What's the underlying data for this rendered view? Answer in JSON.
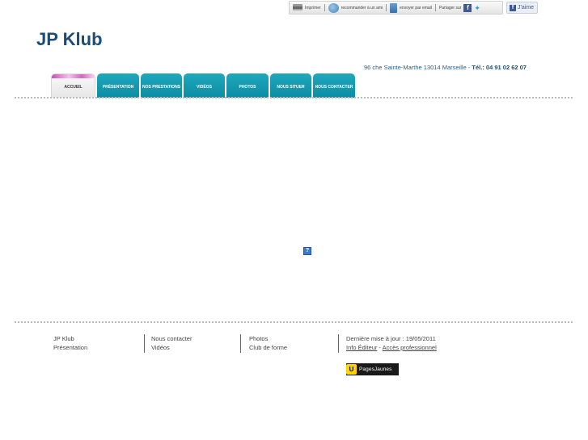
{
  "toolbar": {
    "print_label": "Imprimer",
    "recommend_label": "recommander à un ami",
    "email_label": "envoyer par email",
    "share_label": "Partager sur",
    "facebook_glyph": "f",
    "like_label": "J'aime"
  },
  "site": {
    "title": "JP Klub",
    "address": "96 che Sainte-Marthe 13014 Marseille",
    "separator": " - ",
    "phone": "Tél.: 04 91 02 62 07"
  },
  "nav": {
    "tabs": [
      {
        "label": "Accueil",
        "active": true
      },
      {
        "label": "Présentation"
      },
      {
        "label": "Nos prestations"
      },
      {
        "label": "Vidéos"
      },
      {
        "label": "Photos"
      },
      {
        "label": "Nous situer"
      },
      {
        "label": "Nous contacter"
      }
    ]
  },
  "content": {
    "missing_plugin_glyph": "?"
  },
  "footer": {
    "col1": [
      "JP Klub",
      "Présentation"
    ],
    "col2": [
      "Nous contacter",
      "Vidéos"
    ],
    "col3": [
      "Photos",
      "Club de forme"
    ],
    "last_update": "Dernière mise à jour : 19/05/2011",
    "info_editor": "Info Éditeur",
    "info_sep": " - ",
    "pro_access": "Accès professionnel",
    "pj_label": "PagesJaunes",
    "pj_glyph": "U"
  },
  "colors": {
    "brand_title": "#1a4d78",
    "tab_teal": "#0e8ca3",
    "facebook": "#3b5998",
    "pages_jaunes": "#ffd400"
  }
}
